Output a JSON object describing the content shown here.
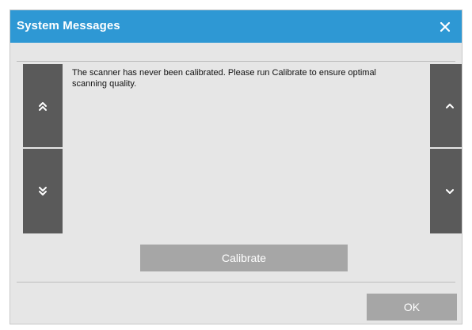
{
  "dialog": {
    "title": "System Messages",
    "close_icon": "close-icon"
  },
  "message": {
    "text": "The scanner has never been calibrated. Please run Calibrate to ensure optimal scanning quality."
  },
  "scroll": {
    "page_up_icon": "double-chevron-up-icon",
    "page_down_icon": "double-chevron-down-icon",
    "line_up_icon": "chevron-up-icon",
    "line_down_icon": "chevron-down-icon"
  },
  "buttons": {
    "calibrate_label": "Calibrate",
    "ok_label": "OK"
  },
  "colors": {
    "title_bar": "#2e98d4",
    "scroll_buttons": "#5a5a5a",
    "action_buttons": "#a6a6a6",
    "background": "#e6e6e6"
  }
}
